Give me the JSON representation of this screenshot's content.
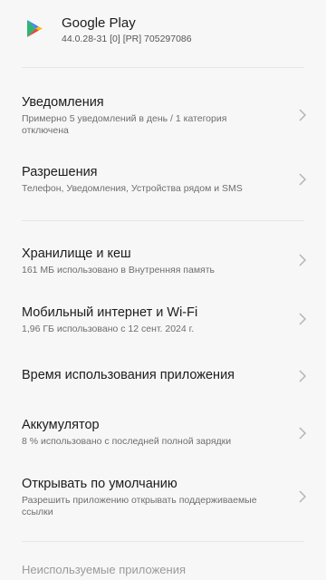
{
  "app": {
    "name": "Google Play",
    "version": "44.0.28-31 [0] [PR] 705297086",
    "icon": "google-play-icon"
  },
  "settings": [
    {
      "id": "notifications",
      "title": "Уведомления",
      "subtitle": "Примерно 5 уведомлений в день / 1 категория отключена"
    },
    {
      "id": "permissions",
      "title": "Разрешения",
      "subtitle": "Телефон, Уведомления, Устройства рядом и SMS"
    },
    {
      "id": "storage",
      "title": "Хранилище и кеш",
      "subtitle": "161 МБ использовано в Внутренняя память"
    },
    {
      "id": "mobile-data",
      "title": "Мобильный интернет и Wi-Fi",
      "subtitle": "1,96 ГБ использовано с 12 сент. 2024 г."
    },
    {
      "id": "screen-time",
      "title": "Время использования приложения",
      "subtitle": ""
    },
    {
      "id": "battery",
      "title": "Аккумулятор",
      "subtitle": "8 % использовано с последней полной зарядки"
    },
    {
      "id": "open-by-default",
      "title": "Открывать по умолчанию",
      "subtitle": "Разрешить приложению открывать поддерживаемые ссылки"
    }
  ],
  "unused_apps": {
    "title": "Неиспользуемые приложения"
  },
  "colors": {
    "background": "#f7f7f7",
    "chevron": "#b5b5b5",
    "divider": "#e6e6e6"
  }
}
